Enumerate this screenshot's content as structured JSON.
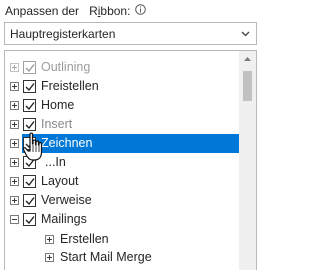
{
  "header": {
    "customize_label": "Anpassen der",
    "ribbon_label_prefix": "R",
    "ribbon_label_underlined": "i",
    "ribbon_label_suffix": "bbon:",
    "info_icon": "info-icon"
  },
  "dropdown": {
    "value": "Hauptregisterkarten",
    "icon": "chevron-down-icon"
  },
  "tree": {
    "items": [
      {
        "label": "Outlining",
        "checked": true,
        "expander": "plus",
        "state": "partially-scrolled"
      },
      {
        "label": "Freistellen",
        "checked": true,
        "expander": "plus"
      },
      {
        "label": "Home",
        "checked": true,
        "expander": "plus"
      },
      {
        "label": "Insert",
        "checked": true,
        "expander": "plus",
        "state": "dimmed"
      },
      {
        "label": "Zeichnen",
        "checked": true,
        "expander": "plus",
        "state": "selected"
      },
      {
        "label": "...In",
        "checked": true,
        "expander": "plus",
        "state": "partially-hidden-by-cursor"
      },
      {
        "label": "Layout",
        "checked": true,
        "expander": "plus"
      },
      {
        "label": "Verweise",
        "checked": true,
        "expander": "plus"
      },
      {
        "label": "Mailings",
        "checked": true,
        "expander": "minus"
      },
      {
        "label": "Erstellen",
        "expander": "plus",
        "level": 2
      },
      {
        "label": "Start Mail Merge",
        "expander": "plus",
        "level": 2,
        "state": "partially-visible"
      }
    ]
  },
  "colors": {
    "selection": "#0078d7",
    "border": "#b9b9b9",
    "text": "#262626"
  },
  "cursor": {
    "icon": "hand-pointer-cursor-icon"
  }
}
